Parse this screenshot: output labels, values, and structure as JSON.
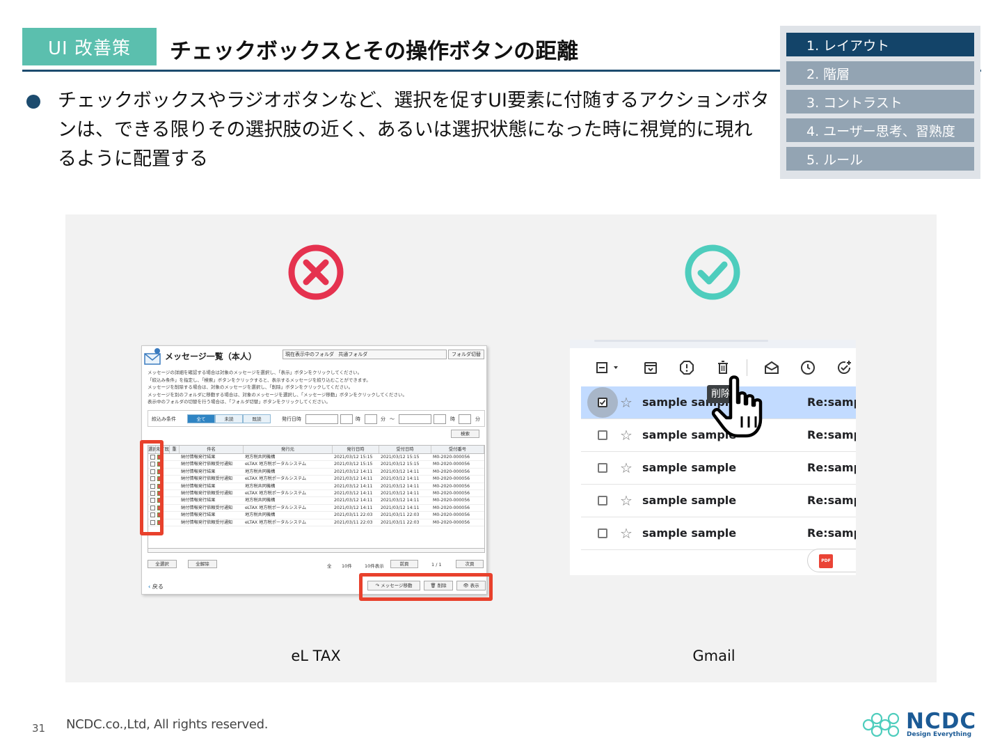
{
  "slide": {
    "tag": "UI 改善策",
    "title": "チェックボックスとその操作ボタンの距離",
    "bullet": "チェックボックスやラジオボタンなど、選択を促すUI要素に付随するアクションボタンは、できる限りその選択肢の近く、あるいは選択状態になった時に視覚的に現れるように配置する",
    "page_number": "31",
    "copyright": "NCDC.co.,Ltd, All rights reserved."
  },
  "toc": {
    "items": [
      {
        "label": "1. レイアウト",
        "active": true
      },
      {
        "label": "2. 階層",
        "active": false
      },
      {
        "label": "3. コントラスト",
        "active": false
      },
      {
        "label": "4. ユーザー思考、習熟度",
        "active": false
      },
      {
        "label": "5. ルール",
        "active": false
      }
    ]
  },
  "examples": {
    "bad_label": "eL TAX",
    "good_label": "Gmail",
    "bad_icon": "x-circle-icon",
    "good_icon": "check-circle-icon",
    "bad_color": "#e5324f",
    "good_color": "#4ecdbd"
  },
  "eltax": {
    "title": "メッセージ一覧（本人）",
    "folder_label": "現在表示中のフォルダ",
    "folder_value": "共通フォルダ",
    "folder_button": "フォルダ切替",
    "desc": [
      "メッセージの詳細を確認する場合は対象のメッセージを選択し、「表示」ボタンをクリックしてください。",
      "「絞込み条件」を指定し、「検索」ボタンをクリックすると、表示するメッセージを絞り込むことができます。",
      "メッセージを削除する場合は、対象のメッセージを選択し、「削除」ボタンをクリックしてください。",
      "メッセージを別のフォルダに移動する場合は、対象のメッセージを選択し、「メッセージ移動」ボタンをクリックしてください。",
      "表示中のフォルダの切替を行う場合は、「フォルダ切替」ボタンをクリックしてください。"
    ],
    "filter_label": "絞込み条件",
    "filter_options": [
      "全て",
      "未読",
      "既読"
    ],
    "date_label": "発行日時",
    "unit_hour": "時",
    "unit_min": "分",
    "tilde": "～",
    "search_button": "検索",
    "columns": [
      "選択",
      "未／既",
      "重",
      "件名",
      "発行元",
      "発行日時",
      "受付日時",
      "受付番号"
    ],
    "rows": [
      [
        "納付情報発行結果",
        "地方税共同機構",
        "2021/03/12 15:15",
        "2021/03/12 15:15",
        "M0-2020-000056"
      ],
      [
        "納付情報発行依頼受付通知",
        "eLTAX 地方税ポータルシステム",
        "2021/03/12 15:15",
        "2021/03/12 15:15",
        "M0-2020-000056"
      ],
      [
        "納付情報発行結果",
        "地方税共同機構",
        "2021/03/12 14:11",
        "2021/03/12 14:11",
        "M0-2020-000056"
      ],
      [
        "納付情報発行依頼受付通知",
        "eLTAX 地方税ポータルシステム",
        "2021/03/12 14:11",
        "2021/03/12 14:11",
        "M0-2020-000056"
      ],
      [
        "納付情報発行結果",
        "地方税共同機構",
        "2021/03/12 14:11",
        "2021/03/12 14:11",
        "M0-2020-000056"
      ],
      [
        "納付情報発行依頼受付通知",
        "eLTAX 地方税ポータルシステム",
        "2021/03/12 14:11",
        "2021/03/12 14:11",
        "M0-2020-000056"
      ],
      [
        "納付情報発行結果",
        "地方税共同機構",
        "2021/03/12 14:11",
        "2021/03/12 14:11",
        "M0-2020-000056"
      ],
      [
        "納付情報発行依頼受付通知",
        "eLTAX 地方税ポータルシステム",
        "2021/03/12 14:11",
        "2021/03/12 14:11",
        "M0-2020-000056"
      ],
      [
        "納付情報発行結果",
        "地方税共同機構",
        "2021/03/11 22:03",
        "2021/03/11 22:03",
        "M0-2020-000056"
      ],
      [
        "納付情報発行依頼受付通知",
        "eLTAX 地方税ポータルシステム",
        "2021/03/11 22:03",
        "2021/03/11 22:03",
        "M0-2020-000056"
      ]
    ],
    "select_all": "全選択",
    "deselect_all": "全解除",
    "total_label": "全",
    "total_count": "10件",
    "per_page": "10件表示",
    "prev": "前頁",
    "page": "1 / 1",
    "next": "次頁",
    "back": "戻る",
    "move_button": "メッセージ移動",
    "delete_button": "削除",
    "view_button": "表示"
  },
  "gmail": {
    "tooltip": "削除",
    "rows": [
      {
        "sender": "sample sample",
        "subject": "Re:samp",
        "selected": true
      },
      {
        "sender": "sample sample",
        "subject": "Re:samp",
        "selected": false
      },
      {
        "sender": "sample sample",
        "subject": "Re:samp",
        "selected": false
      },
      {
        "sender": "sample sample",
        "subject": "Re:samp",
        "selected": false
      },
      {
        "sender": "sample sample",
        "subject": "Re:samp",
        "selected": false
      }
    ],
    "attachment_label": "PDF",
    "selected_color": "#c2dbff"
  },
  "logo": {
    "name": "NCDC",
    "tagline": "Design Everything",
    "color": "#1b5a95"
  }
}
